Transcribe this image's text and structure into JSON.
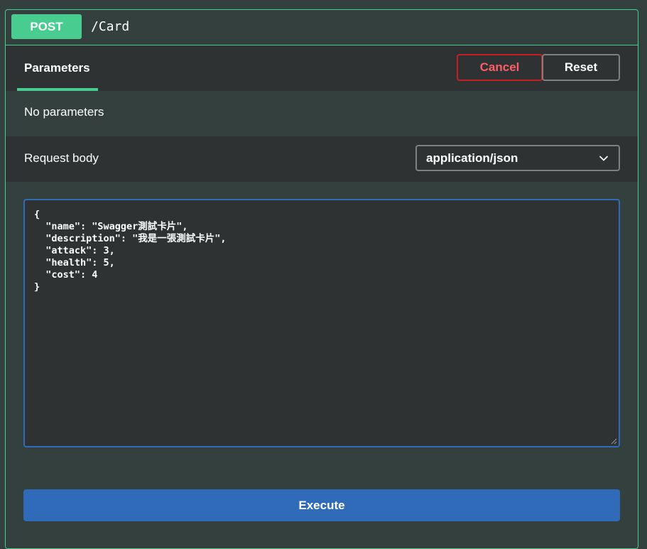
{
  "operation": {
    "method": "POST",
    "path": "/Card"
  },
  "tabs": {
    "parameters_label": "Parameters"
  },
  "buttons": {
    "cancel_label": "Cancel",
    "reset_label": "Reset",
    "execute_label": "Execute"
  },
  "parameters": {
    "empty_text": "No parameters"
  },
  "request_body": {
    "label": "Request body",
    "content_type": "application/json",
    "editor_text": "{\n  \"name\": \"Swagger測試卡片\",\n  \"description\": \"我是一張測試卡片\",\n  \"attack\": 3,\n  \"health\": 5,\n  \"cost\": 4\n}"
  },
  "colors": {
    "post_green": "#49cc90",
    "cancel_red": "#c51f25",
    "execute_blue": "#2f6bb8"
  },
  "icons": {
    "select": "chevron-down-icon",
    "editor": "resize-handle-icon"
  }
}
